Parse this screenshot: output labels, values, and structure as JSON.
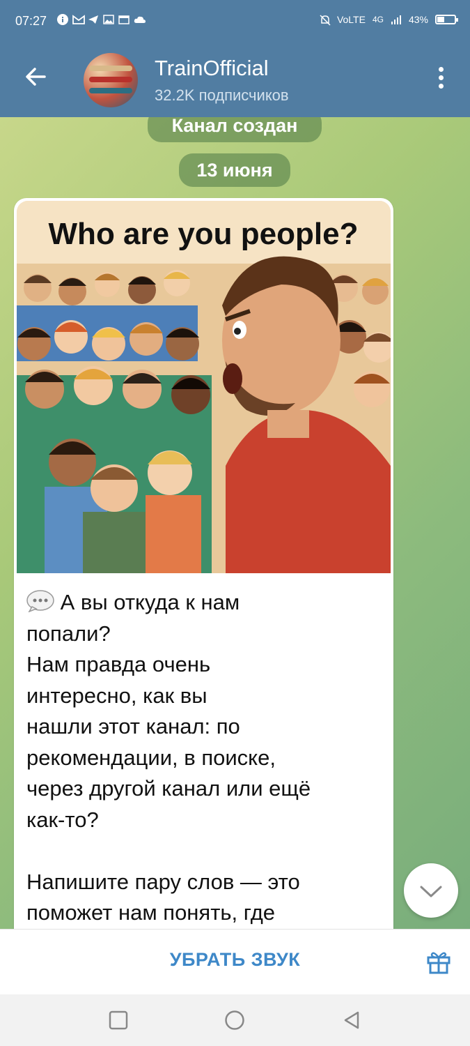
{
  "status_bar": {
    "time": "07:27",
    "network": "VoLTE",
    "signal": "4G",
    "battery": "43%",
    "battery_level": 0.43,
    "icons": [
      "info-icon",
      "gmail-icon",
      "telegram-icon",
      "gallery-icon",
      "calendar-icon",
      "cloud-icon",
      "mute-bell-icon",
      "signal-icon",
      "battery-icon"
    ]
  },
  "header": {
    "channel_name": "TrainOfficial",
    "subscribers": "32.2K подписчиков"
  },
  "chat": {
    "service_created": "Канал создан",
    "date_pill": "13 июня",
    "post": {
      "image_caption": "Who are you people?",
      "lines": [
        "А вы откуда к нам",
        "попали?",
        "Нам правда очень",
        "интересно, как вы",
        "нашли этот канал: по",
        "рекомендации, в поиске,",
        "через другой канал или ещё",
        "как-то?",
        "",
        "Напишите пару слов — это",
        "поможет нам понять, где"
      ]
    }
  },
  "bottom": {
    "mute_label": "УБРАТЬ ЗВУК"
  },
  "colors": {
    "header_bg": "#517da2",
    "accent": "#3e88c8"
  }
}
